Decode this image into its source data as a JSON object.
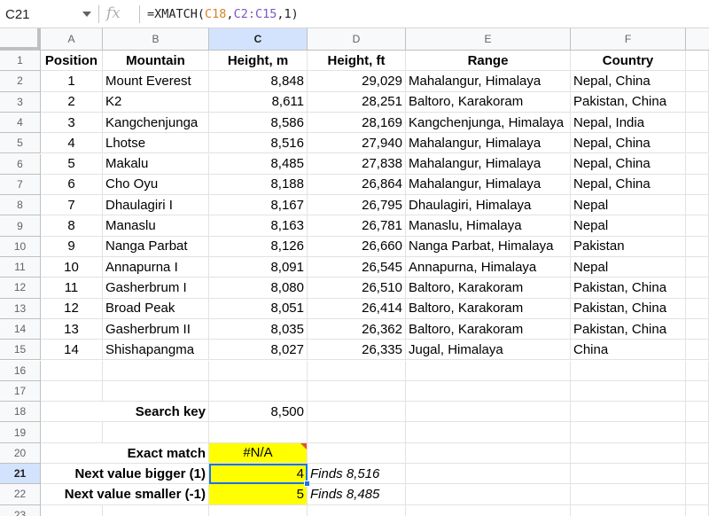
{
  "formula_bar": {
    "cell_ref": "C21",
    "fx_label": "fx",
    "formula_prefix": "=XMATCH(",
    "formula_arg1": "C18",
    "formula_sep1": ",",
    "formula_arg2": "C2:C15",
    "formula_suffix": ",1)"
  },
  "columns": [
    "A",
    "B",
    "C",
    "D",
    "E",
    "F"
  ],
  "row_numbers": [
    "1",
    "2",
    "3",
    "4",
    "5",
    "6",
    "7",
    "8",
    "9",
    "10",
    "11",
    "12",
    "13",
    "14",
    "15",
    "16",
    "17",
    "18",
    "19",
    "20",
    "21",
    "22",
    "23"
  ],
  "table": {
    "headers": [
      "Position",
      "Mountain",
      "Height, m",
      "Height, ft",
      "Range",
      "Country"
    ],
    "rows": [
      [
        "1",
        "Mount Everest",
        "8,848",
        "29,029",
        "Mahalangur, Himalaya",
        "Nepal, China"
      ],
      [
        "2",
        "K2",
        "8,611",
        "28,251",
        "Baltoro, Karakoram",
        "Pakistan, China"
      ],
      [
        "3",
        "Kangchenjunga",
        "8,586",
        "28,169",
        "Kangchenjunga, Himalaya",
        "Nepal, India"
      ],
      [
        "4",
        "Lhotse",
        "8,516",
        "27,940",
        "Mahalangur, Himalaya",
        "Nepal, China"
      ],
      [
        "5",
        "Makalu",
        "8,485",
        "27,838",
        "Mahalangur, Himalaya",
        "Nepal, China"
      ],
      [
        "6",
        "Cho Oyu",
        "8,188",
        "26,864",
        "Mahalangur, Himalaya",
        "Nepal, China"
      ],
      [
        "7",
        "Dhaulagiri I",
        "8,167",
        "26,795",
        "Dhaulagiri, Himalaya",
        "Nepal"
      ],
      [
        "8",
        "Manaslu",
        "8,163",
        "26,781",
        "Manaslu, Himalaya",
        "Nepal"
      ],
      [
        "9",
        "Nanga Parbat",
        "8,126",
        "26,660",
        "Nanga Parbat, Himalaya",
        "Pakistan"
      ],
      [
        "10",
        "Annapurna I",
        "8,091",
        "26,545",
        "Annapurna, Himalaya",
        "Nepal"
      ],
      [
        "11",
        "Gasherbrum I",
        "8,080",
        "26,510",
        "Baltoro, Karakoram",
        "Pakistan, China"
      ],
      [
        "12",
        "Broad Peak",
        "8,051",
        "26,414",
        "Baltoro, Karakoram",
        "Pakistan, China"
      ],
      [
        "13",
        "Gasherbrum II",
        "8,035",
        "26,362",
        "Baltoro, Karakoram",
        "Pakistan, China"
      ],
      [
        "14",
        "Shishapangma",
        "8,027",
        "26,335",
        "Jugal, Himalaya",
        "China"
      ]
    ]
  },
  "lookup": {
    "search_key_label": "Search key",
    "search_key_value": "8,500",
    "exact_label": "Exact match",
    "exact_value": "#N/A",
    "bigger_label": "Next value bigger (1)",
    "bigger_value": "4",
    "bigger_note": "Finds 8,516",
    "smaller_label": "Next value smaller (-1)",
    "smaller_value": "5",
    "smaller_note": "Finds 8,485"
  },
  "colors": {
    "highlight": "#ffff00",
    "selection": "#1a73e8",
    "error_marker": "#e8502e"
  }
}
